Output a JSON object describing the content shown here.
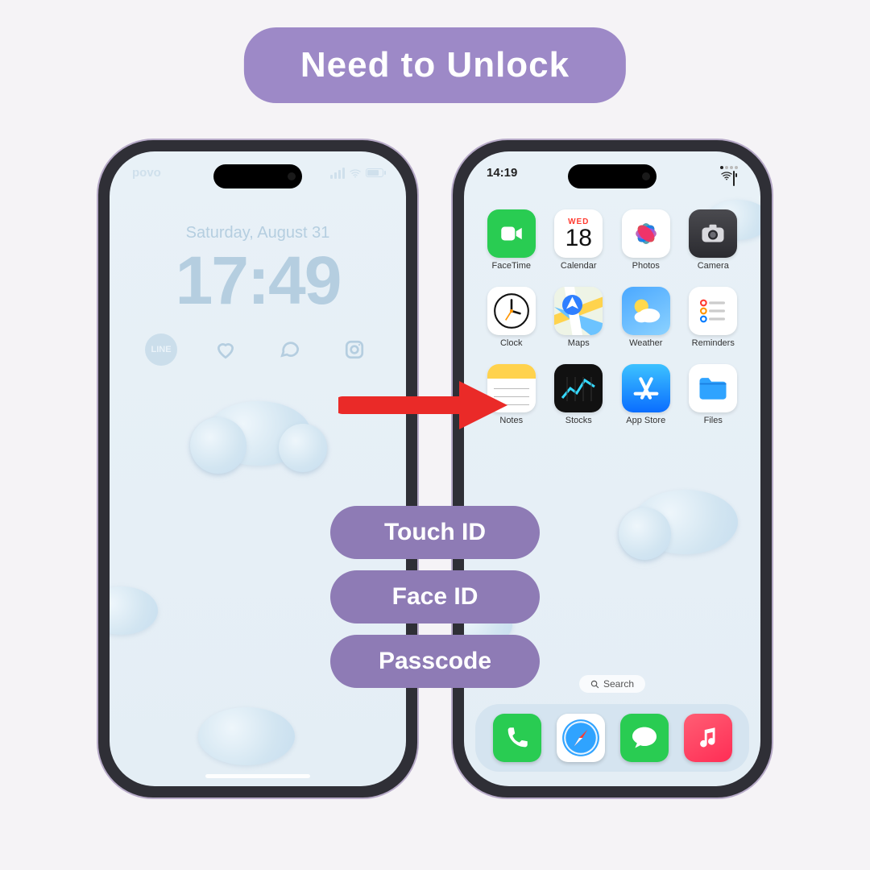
{
  "title": "Need to Unlock",
  "methods": [
    "Touch ID",
    "Face ID",
    "Passcode"
  ],
  "lock_screen": {
    "carrier": "povo",
    "date": "Saturday, August 31",
    "time": "17:49",
    "widgets": [
      "line",
      "heart",
      "chat",
      "instagram"
    ]
  },
  "home_screen": {
    "status_time": "14:19",
    "calendar_weekday": "WED",
    "calendar_day": "18",
    "apps": [
      {
        "name": "FaceTime"
      },
      {
        "name": "Calendar"
      },
      {
        "name": "Photos"
      },
      {
        "name": "Camera"
      },
      {
        "name": "Clock"
      },
      {
        "name": "Maps"
      },
      {
        "name": "Weather"
      },
      {
        "name": "Reminders"
      },
      {
        "name": "Notes"
      },
      {
        "name": "Stocks"
      },
      {
        "name": "App Store"
      },
      {
        "name": "Files"
      }
    ],
    "search_label": "Search",
    "dock": [
      "Phone",
      "Safari",
      "Messages",
      "Music"
    ]
  },
  "colors": {
    "pill": "#9d89c7",
    "method_pill": "#8e7bb5",
    "arrow": "#ea2a28"
  }
}
